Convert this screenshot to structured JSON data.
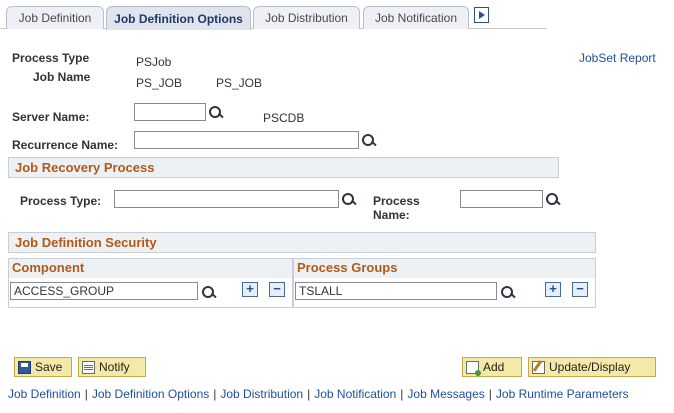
{
  "tabs": [
    {
      "label": "Job Definition"
    },
    {
      "label": "Job Definition Options"
    },
    {
      "label": "Job Distribution"
    },
    {
      "label": "Job Notification"
    }
  ],
  "header": {
    "process_type_label": "Process Type",
    "process_type_value": "PSJob",
    "job_name_label": "Job Name",
    "job_name_value": "PS_JOB",
    "job_name_desc": "PS_JOB",
    "jobset_report_link": "JobSet Report"
  },
  "server": {
    "label": "Server Name:",
    "value": "",
    "desc": "PSCDB"
  },
  "recurrence": {
    "label": "Recurrence Name:",
    "value": ""
  },
  "recovery": {
    "title": "Job Recovery Process",
    "process_type_label": "Process Type:",
    "process_type_value": "",
    "process_name_label_1": "Process",
    "process_name_label_2": "Name:",
    "process_name_value": ""
  },
  "security": {
    "title": "Job Definition Security",
    "component_header": "Component",
    "component_value": "ACCESS_GROUP",
    "groups_header": "Process Groups",
    "groups_value": "TSLALL",
    "add_row": "+",
    "delete_row": "−"
  },
  "buttons": {
    "save": "Save",
    "notify": "Notify",
    "add": "Add",
    "update": "Update/Display"
  },
  "footer_links": [
    "Job Definition",
    "Job Definition Options",
    "Job Distribution",
    "Job Notification",
    "Job Messages",
    "Job Runtime Parameters"
  ]
}
